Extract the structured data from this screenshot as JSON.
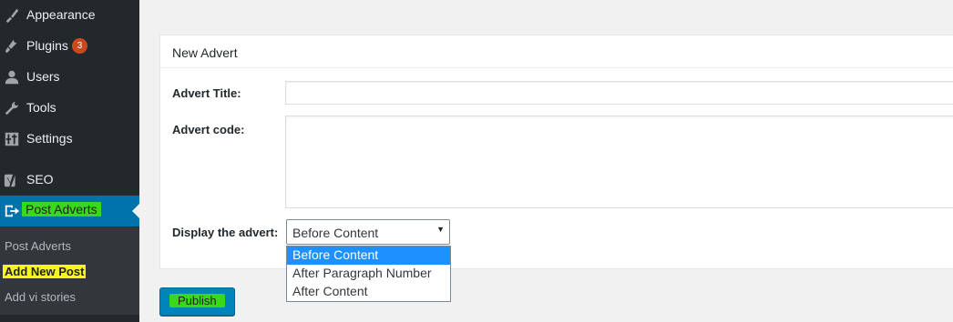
{
  "sidebar": {
    "menu": [
      {
        "label": "Appearance",
        "icon": "brush-icon"
      },
      {
        "label": "Plugins",
        "icon": "plug-icon",
        "badge": "3"
      },
      {
        "label": "Users",
        "icon": "user-icon"
      },
      {
        "label": "Tools",
        "icon": "wrench-icon"
      },
      {
        "label": "Settings",
        "icon": "settings-icon"
      },
      {
        "label": "SEO",
        "icon": "yoast-icon"
      },
      {
        "label": "Post Adverts",
        "icon": "exit-icon",
        "active": true
      }
    ],
    "submenu": [
      "Post Adverts",
      "Add New Post",
      "Add vi stories"
    ]
  },
  "panel": {
    "title": "New Advert",
    "advert_title_label": "Advert Title:",
    "advert_title_value": "",
    "advert_code_label": "Advert code:",
    "advert_code_value": "",
    "display_label": "Display the advert:",
    "display_selected": "Before Content",
    "display_options": [
      "Before Content",
      "After Paragraph Number",
      "After Content"
    ]
  },
  "publish_label": "Publish",
  "colors": {
    "sidebar_bg": "#23282d",
    "active_menu_bg": "#0073aa",
    "highlight_green": "#39d81c",
    "highlight_yellow": "#f6f61c",
    "badge": "#ca4a1f",
    "primary_button": "#0085ba",
    "dropdown_selected": "#1e90ff"
  }
}
